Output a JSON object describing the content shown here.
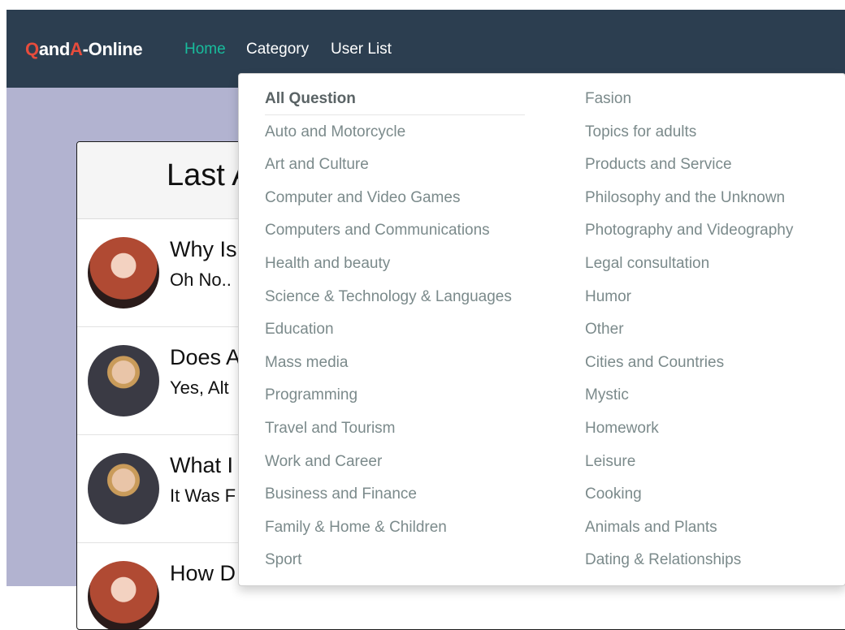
{
  "brand": {
    "q": "Q",
    "and": "and",
    "a": "A",
    "online": "-Online"
  },
  "nav": {
    "home": "Home",
    "category": "Category",
    "user_list": "User List"
  },
  "main": {
    "title": "Last A",
    "questions": [
      {
        "title": "Why Is",
        "sub": "Oh No.."
      },
      {
        "title": "Does A",
        "sub": "Yes, Alt"
      },
      {
        "title": "What I",
        "sub": "It Was F"
      },
      {
        "title": "How D",
        "sub": ""
      }
    ]
  },
  "dropdown": {
    "left": [
      "All Question",
      "Auto and Motorcycle",
      "Art and Culture",
      "Computer and Video Games",
      "Computers and Communications",
      "Health and beauty",
      "Science & Technology & Languages",
      "Education",
      "Mass media",
      "Programming",
      "Travel and Tourism",
      "Work and Career",
      "Business and Finance",
      "Family & Home & Children",
      "Sport"
    ],
    "right": [
      "Fasion",
      "Topics for adults",
      "Products and Service",
      "Philosophy and the Unknown",
      "Photography and Videography",
      "Legal consultation",
      "Humor",
      "Other",
      "Cities and Countries",
      "Mystic",
      "Homework",
      "Leisure",
      "Cooking",
      "Animals and Plants",
      "Dating & Relationships"
    ]
  },
  "colors": {
    "navbar": "#2c3e50",
    "active_link": "#18bc9c",
    "brand_accent": "#e74c3c",
    "page_bg": "#b2b3d0"
  }
}
